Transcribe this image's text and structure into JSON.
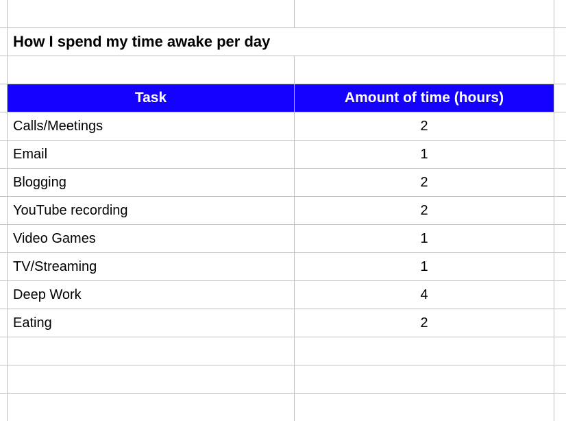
{
  "title": "How I spend my time awake per day",
  "headers": {
    "task": "Task",
    "amount": "Amount of time (hours)"
  },
  "rows": [
    {
      "task": "Calls/Meetings",
      "amount": "2"
    },
    {
      "task": "Email",
      "amount": "1"
    },
    {
      "task": "Blogging",
      "amount": "2"
    },
    {
      "task": "YouTube recording",
      "amount": "2"
    },
    {
      "task": "Video Games",
      "amount": "1"
    },
    {
      "task": "TV/Streaming",
      "amount": "1"
    },
    {
      "task": "Deep Work",
      "amount": "4"
    },
    {
      "task": "Eating",
      "amount": "2"
    }
  ],
  "chart_data": {
    "type": "table",
    "title": "How I spend my time awake per day",
    "columns": [
      "Task",
      "Amount of time (hours)"
    ],
    "data": [
      [
        "Calls/Meetings",
        2
      ],
      [
        "Email",
        1
      ],
      [
        "Blogging",
        2
      ],
      [
        "YouTube recording",
        2
      ],
      [
        "Video Games",
        1
      ],
      [
        "TV/Streaming",
        1
      ],
      [
        "Deep Work",
        4
      ],
      [
        "Eating",
        2
      ]
    ]
  }
}
